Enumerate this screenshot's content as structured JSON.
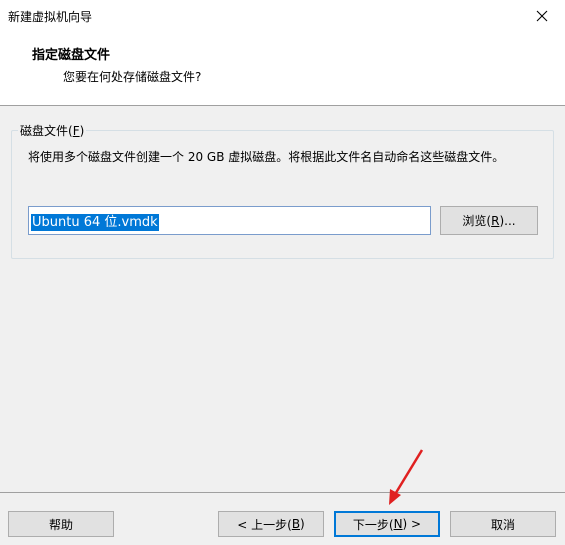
{
  "window": {
    "title": "新建虚拟机向导"
  },
  "header": {
    "title": "指定磁盘文件",
    "subtitle": "您要在何处存储磁盘文件?"
  },
  "disk_file_group": {
    "label_prefix": "磁盘文件(",
    "label_accel": "F",
    "label_suffix": ")",
    "description": "将使用多个磁盘文件创建一个 20 GB 虚拟磁盘。将根据此文件名自动命名这些磁盘文件。",
    "input_value": "Ubuntu 64 位.vmdk",
    "browse_prefix": "浏览(",
    "browse_accel": "R",
    "browse_suffix": ")..."
  },
  "footer": {
    "help": "帮助",
    "back_prefix": "< 上一步(",
    "back_accel": "B",
    "back_suffix": ")",
    "next_prefix": "下一步(",
    "next_accel": "N",
    "next_suffix": ") >",
    "cancel": "取消"
  },
  "colors": {
    "selection": "#0078d7",
    "annotation_arrow": "#e02020"
  },
  "icons": {
    "close": "close-icon",
    "arrow": "annotation-arrow"
  }
}
